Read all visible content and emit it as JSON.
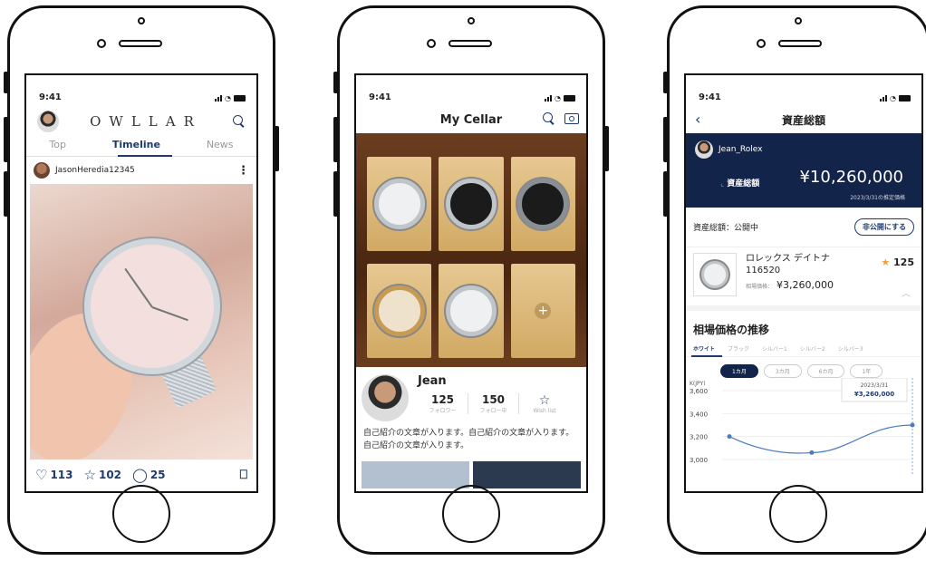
{
  "status_time": "9:41",
  "feed": {
    "logo": "OWLLAR",
    "tabs": [
      "Top",
      "Timeline",
      "News"
    ],
    "post_user": "JasonHeredia12345",
    "more": "⋮",
    "likes": "113",
    "stars": "102",
    "comments": "25"
  },
  "cellar": {
    "title": "My Cellar",
    "name": "Jean",
    "followers": {
      "value": "125",
      "label": "フォロワー"
    },
    "following": {
      "value": "150",
      "label": "フォロー中"
    },
    "wishlist_label": "Wish list",
    "bio": "自己紹介の文章が入ります。自己紹介の文章が入ります。自己紹介の文章が入ります。",
    "slots": [
      "white",
      "black",
      "black",
      "gold",
      "white",
      "empty"
    ]
  },
  "assets": {
    "title": "資産総額",
    "user": "Jean_Rolex",
    "label": "資産総額",
    "amount": "¥10,260,000",
    "date_note": "2023/3/31の推定価格",
    "public_label": "資産総額：公開中",
    "private_button": "非公開にする",
    "holding": {
      "name": "ロレックス デイトナ",
      "ref": "116520",
      "price_label": "相場価格：",
      "price": "¥3,260,000",
      "star_count": "125"
    },
    "chart_section": "相場価格の推移",
    "color_tabs": [
      "ホワイト",
      "ブラック",
      "シルバー1",
      "シルバー2",
      "シルバー3"
    ],
    "periods": [
      "1カ月",
      "3カ月",
      "6カ月",
      "1年"
    ],
    "tooltip_date": "2023/3/31",
    "tooltip_price": "¥3,260,000"
  },
  "chart_data": {
    "type": "line",
    "ylabel": "K(JPY)",
    "yticks": [
      3600,
      3400,
      3200,
      3000
    ],
    "ylim": [
      3000,
      3600
    ],
    "series": [
      {
        "values": [
          3200,
          3060,
          3300
        ]
      }
    ],
    "points_x": [
      0,
      0.45,
      1
    ]
  },
  "colors": {
    "navy": "#13244a",
    "accent": "#1e3a6e",
    "green": "#3ab58a",
    "star": "#f0a13a"
  }
}
